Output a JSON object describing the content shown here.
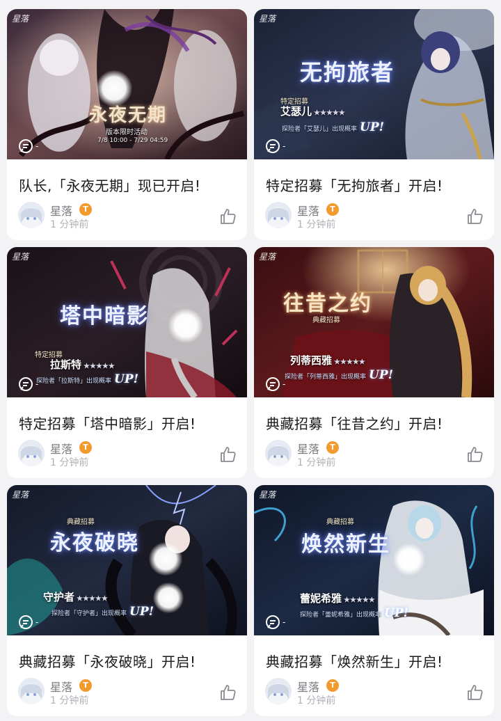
{
  "colors": {
    "page_bg": "#f3f3f5",
    "card_bg": "#ffffff",
    "title_text": "#1a1a1a",
    "author_text": "#7a7a80",
    "time_text": "#b0b0b6",
    "level_badge": "#f39a2d"
  },
  "posts": [
    {
      "title": "队长,「永夜无期」现已开启!",
      "author": "星落",
      "level": "T",
      "time": "1 分钟前",
      "comment_count": "-",
      "studio_mark": "星落",
      "banner": {
        "title": "永夜无期",
        "sub": "版本限时活动",
        "dates": "7/8 10:00 - 7/29 04:59"
      }
    },
    {
      "title": "特定招募「无拘旅者」开启!",
      "author": "星落",
      "level": "T",
      "time": "1 分钟前",
      "comment_count": "-",
      "studio_mark": "星落",
      "banner": {
        "title": "无拘旅者",
        "tag": "特定招募",
        "char": "艾瑟儿",
        "stars": "★★★★★",
        "rate": "探险者「艾瑟儿」出现概率",
        "up": "UP!"
      }
    },
    {
      "title": "特定招募「塔中暗影」开启!",
      "author": "星落",
      "level": "T",
      "time": "1 分钟前",
      "comment_count": "-",
      "studio_mark": "星落",
      "banner": {
        "title": "塔中暗影",
        "tag": "特定招募",
        "char": "拉斯特",
        "stars": "★★★★★",
        "rate": "探险者「拉斯特」出现概率",
        "up": "UP!"
      }
    },
    {
      "title": "典藏招募「往昔之约」开启!",
      "author": "星落",
      "level": "T",
      "time": "1 分钟前",
      "comment_count": "-",
      "studio_mark": "星落",
      "banner": {
        "title": "往昔之约",
        "tag": "典藏招募",
        "char": "列蒂西雅",
        "stars": "★★★★★",
        "rate": "探险者「列蒂西雅」出现概率",
        "up": "UP!"
      }
    },
    {
      "title": "典藏招募「永夜破晓」开启!",
      "author": "星落",
      "level": "T",
      "time": "1 分钟前",
      "comment_count": "-",
      "studio_mark": "星落",
      "banner": {
        "title": "永夜破晓",
        "tag": "典藏招募",
        "char": "守护者",
        "stars": "★★★★★",
        "rate": "探险者「守护者」出现概率",
        "up": "UP!"
      }
    },
    {
      "title": "典藏招募「焕然新生」开启!",
      "author": "星落",
      "level": "T",
      "time": "1 分钟前",
      "comment_count": "-",
      "studio_mark": "星落",
      "banner": {
        "title": "焕然新生",
        "tag": "典藏招募",
        "char": "蕾妮希雅",
        "stars": "★★★★★",
        "rate": "探险者「蕾妮希雅」出现概率",
        "up": "UP!"
      }
    }
  ]
}
